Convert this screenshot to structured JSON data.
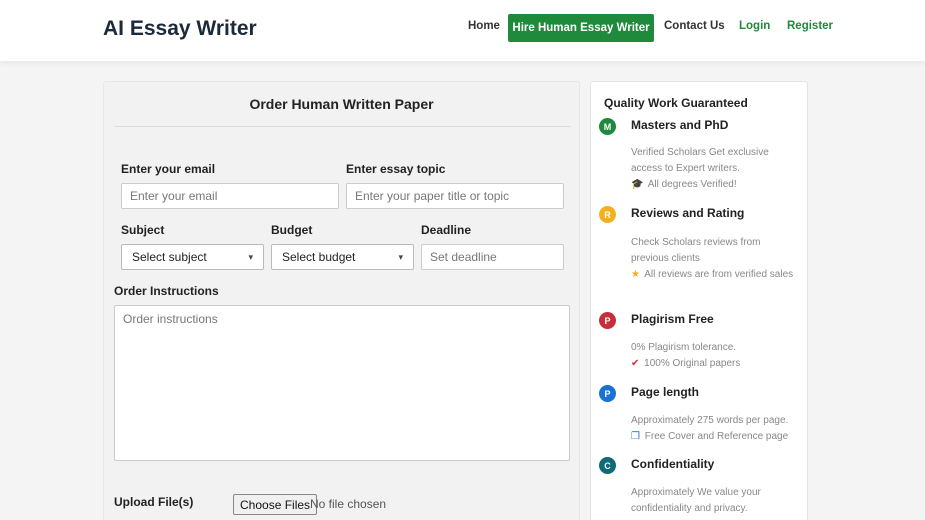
{
  "nav": {
    "brand": "AI Essay Writer",
    "home": "Home",
    "hire": "Hire Human Essay Writer",
    "contact": "Contact Us",
    "login": "Login",
    "register": "Register"
  },
  "form": {
    "title": "Order Human Written Paper",
    "email_label": "Enter your email",
    "email_placeholder": "Enter your email",
    "topic_label": "Enter essay topic",
    "topic_placeholder": "Enter your paper title or topic",
    "subject_label": "Subject",
    "subject_value": "Select subject",
    "budget_label": "Budget",
    "budget_value": "Select budget",
    "deadline_label": "Deadline",
    "deadline_placeholder": "Set deadline",
    "instructions_label": "Order Instructions",
    "instructions_placeholder": "Order instructions",
    "upload_label": "Upload File(s)",
    "upload_button": "Choose Files",
    "upload_status": "No file chosen"
  },
  "sidebar": {
    "title": "Quality Work Guaranteed",
    "features": [
      {
        "badge": "M",
        "color": "#1f8a3b",
        "title": "Masters and PhD",
        "desc": "Verified Scholars  Get exclusive access to Expert writers.",
        "extra_icon": "graduation-cap-icon",
        "extra_glyph": "🎓",
        "extra": "All degrees Verified!"
      },
      {
        "badge": "R",
        "color": "#f2b01e",
        "title": "Reviews and Rating",
        "desc": "Check Scholars  reviews from previous clients",
        "extra_icon": "star-icon",
        "extra_glyph": "★",
        "extra": "All reviews are from verified sales"
      },
      {
        "badge": "P",
        "color": "#c62f3a",
        "title": "Plagirism Free",
        "desc": "0% Plagirism tolerance.",
        "extra_icon": "check-circle-icon",
        "extra_glyph": "✔",
        "extra": "100% Original papers"
      },
      {
        "badge": "P",
        "color": "#1a73d1",
        "title": "Page length",
        "desc": " Approximately 275 words per page.",
        "extra_icon": "copy-icon",
        "extra_glyph": "❐",
        "extra": "Free Cover and Reference page"
      },
      {
        "badge": "C",
        "color": "#0f6a7a",
        "title": "Confidentiality",
        "desc": "Approximately  We value your confidentiality and privacy.",
        "extra_icon": "",
        "extra_glyph": "",
        "extra": ""
      }
    ]
  },
  "colors": {
    "accent": "#1f8a3b"
  }
}
